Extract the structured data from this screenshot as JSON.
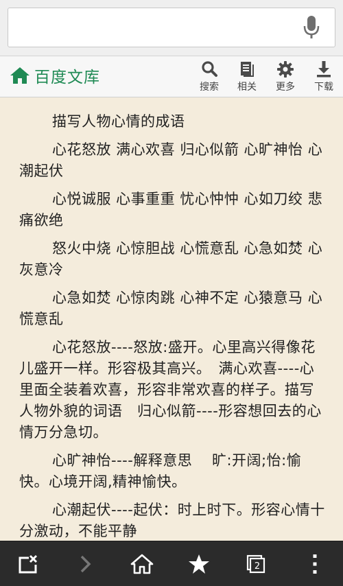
{
  "search": {
    "value": "",
    "placeholder": ""
  },
  "brand": {
    "name": "百度文库",
    "color": "#1f8a54"
  },
  "toolbar": {
    "items": [
      {
        "icon": "search-icon",
        "label": "搜索"
      },
      {
        "icon": "document-icon",
        "label": "相关"
      },
      {
        "icon": "gear-icon",
        "label": "更多"
      },
      {
        "icon": "download-icon",
        "label": "下载"
      }
    ]
  },
  "document": {
    "paragraphs": [
      "描写人物心情的成语",
      "心花怒放 满心欢喜 归心似箭 心旷神怡 心潮起伏",
      "心悦诚服 心事重重 忧心忡忡 心如刀绞 悲痛欲绝",
      "怒火中烧 心惊胆战 心慌意乱 心急如焚 心灰意冷",
      "心急如焚 心惊肉跳 心神不定 心猿意马 心慌意乱",
      "心花怒放----怒放:盛开。心里高兴得像花儿盛开一样。形容极其高兴。　满心欢喜----心里面全装着欢喜，形容非常欢喜的样子。描写人物外貌的词语　归心似箭----形容想回去的心情万分急切。",
      "心旷神怡----解释意思　 旷:开阔;怡:愉快。心境开阔,精神愉快。",
      "心潮起伏----起伏：时上时下。形容心情十分激动，不能平静"
    ]
  },
  "bottom_nav": {
    "items": [
      "close-tab-icon",
      "forward-icon",
      "home-icon",
      "bookmark-star-icon",
      "tabs-icon",
      "menu-dots-icon"
    ],
    "tab_count": "2"
  }
}
